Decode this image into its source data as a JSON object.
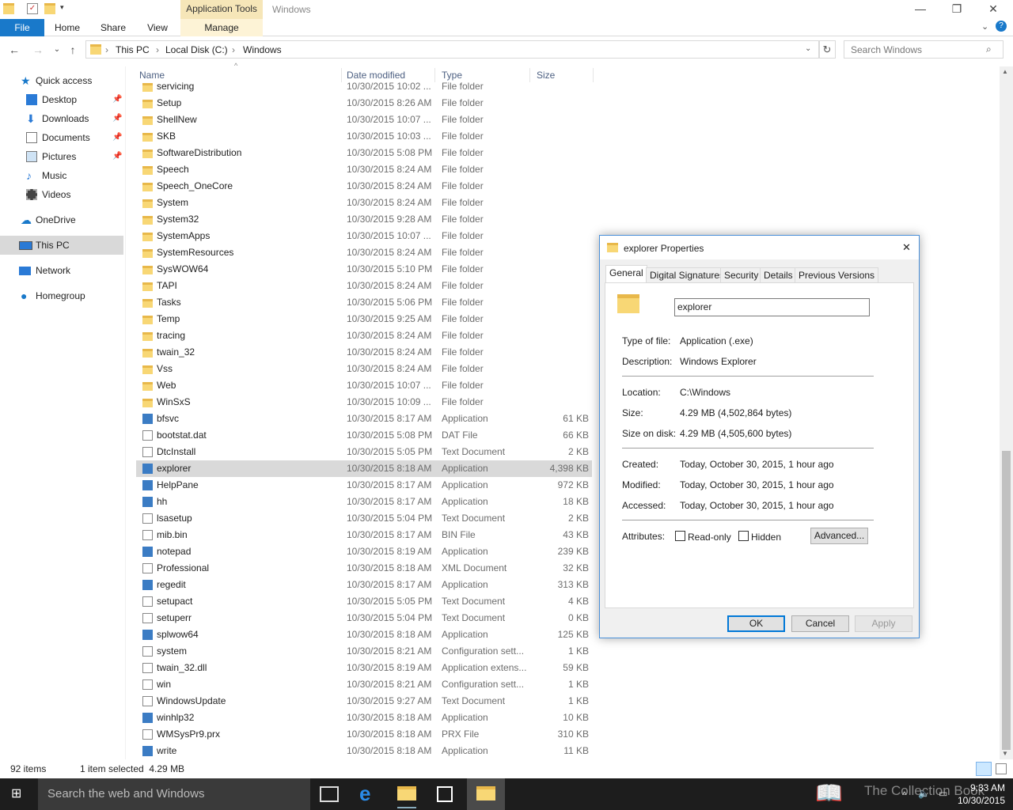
{
  "window": {
    "context_tab": "Application Tools",
    "title": "Windows",
    "min_icon": "minimize-icon",
    "max_icon": "restore-icon",
    "close_icon": "close-icon"
  },
  "ribbon": {
    "file": "File",
    "tabs": [
      "Home",
      "Share",
      "View"
    ],
    "manage": "Manage"
  },
  "address": {
    "crumbs": [
      "This PC",
      "Local Disk (C:)",
      "Windows"
    ],
    "search_placeholder": "Search Windows"
  },
  "nav": {
    "quick_access": "Quick access",
    "items": [
      "Desktop",
      "Downloads",
      "Documents",
      "Pictures",
      "Music",
      "Videos"
    ],
    "onedrive": "OneDrive",
    "thispc": "This PC",
    "network": "Network",
    "homegroup": "Homegroup"
  },
  "columns": {
    "name": "Name",
    "date": "Date modified",
    "type": "Type",
    "size": "Size"
  },
  "files": [
    {
      "name": "servicing",
      "date": "10/30/2015 10:02 ...",
      "type": "File folder",
      "size": "",
      "kind": "folder"
    },
    {
      "name": "Setup",
      "date": "10/30/2015 8:26 AM",
      "type": "File folder",
      "size": "",
      "kind": "folder"
    },
    {
      "name": "ShellNew",
      "date": "10/30/2015 10:07 ...",
      "type": "File folder",
      "size": "",
      "kind": "folder"
    },
    {
      "name": "SKB",
      "date": "10/30/2015 10:03 ...",
      "type": "File folder",
      "size": "",
      "kind": "folder"
    },
    {
      "name": "SoftwareDistribution",
      "date": "10/30/2015 5:08 PM",
      "type": "File folder",
      "size": "",
      "kind": "folder"
    },
    {
      "name": "Speech",
      "date": "10/30/2015 8:24 AM",
      "type": "File folder",
      "size": "",
      "kind": "folder"
    },
    {
      "name": "Speech_OneCore",
      "date": "10/30/2015 8:24 AM",
      "type": "File folder",
      "size": "",
      "kind": "folder"
    },
    {
      "name": "System",
      "date": "10/30/2015 8:24 AM",
      "type": "File folder",
      "size": "",
      "kind": "folder"
    },
    {
      "name": "System32",
      "date": "10/30/2015 9:28 AM",
      "type": "File folder",
      "size": "",
      "kind": "folder"
    },
    {
      "name": "SystemApps",
      "date": "10/30/2015 10:07 ...",
      "type": "File folder",
      "size": "",
      "kind": "folder"
    },
    {
      "name": "SystemResources",
      "date": "10/30/2015 8:24 AM",
      "type": "File folder",
      "size": "",
      "kind": "folder"
    },
    {
      "name": "SysWOW64",
      "date": "10/30/2015 5:10 PM",
      "type": "File folder",
      "size": "",
      "kind": "folder"
    },
    {
      "name": "TAPI",
      "date": "10/30/2015 8:24 AM",
      "type": "File folder",
      "size": "",
      "kind": "folder"
    },
    {
      "name": "Tasks",
      "date": "10/30/2015 5:06 PM",
      "type": "File folder",
      "size": "",
      "kind": "folder"
    },
    {
      "name": "Temp",
      "date": "10/30/2015 9:25 AM",
      "type": "File folder",
      "size": "",
      "kind": "folder"
    },
    {
      "name": "tracing",
      "date": "10/30/2015 8:24 AM",
      "type": "File folder",
      "size": "",
      "kind": "folder"
    },
    {
      "name": "twain_32",
      "date": "10/30/2015 8:24 AM",
      "type": "File folder",
      "size": "",
      "kind": "folder"
    },
    {
      "name": "Vss",
      "date": "10/30/2015 8:24 AM",
      "type": "File folder",
      "size": "",
      "kind": "folder"
    },
    {
      "name": "Web",
      "date": "10/30/2015 10:07 ...",
      "type": "File folder",
      "size": "",
      "kind": "folder"
    },
    {
      "name": "WinSxS",
      "date": "10/30/2015 10:09 ...",
      "type": "File folder",
      "size": "",
      "kind": "folder"
    },
    {
      "name": "bfsvc",
      "date": "10/30/2015 8:17 AM",
      "type": "Application",
      "size": "61 KB",
      "kind": "app"
    },
    {
      "name": "bootstat.dat",
      "date": "10/30/2015 5:08 PM",
      "type": "DAT File",
      "size": "66 KB",
      "kind": "file"
    },
    {
      "name": "DtcInstall",
      "date": "10/30/2015 5:05 PM",
      "type": "Text Document",
      "size": "2 KB",
      "kind": "file"
    },
    {
      "name": "explorer",
      "date": "10/30/2015 8:18 AM",
      "type": "Application",
      "size": "4,398 KB",
      "kind": "app"
    },
    {
      "name": "HelpPane",
      "date": "10/30/2015 8:17 AM",
      "type": "Application",
      "size": "972 KB",
      "kind": "app"
    },
    {
      "name": "hh",
      "date": "10/30/2015 8:17 AM",
      "type": "Application",
      "size": "18 KB",
      "kind": "app"
    },
    {
      "name": "lsasetup",
      "date": "10/30/2015 5:04 PM",
      "type": "Text Document",
      "size": "2 KB",
      "kind": "file"
    },
    {
      "name": "mib.bin",
      "date": "10/30/2015 8:17 AM",
      "type": "BIN File",
      "size": "43 KB",
      "kind": "file"
    },
    {
      "name": "notepad",
      "date": "10/30/2015 8:19 AM",
      "type": "Application",
      "size": "239 KB",
      "kind": "app"
    },
    {
      "name": "Professional",
      "date": "10/30/2015 8:18 AM",
      "type": "XML Document",
      "size": "32 KB",
      "kind": "file"
    },
    {
      "name": "regedit",
      "date": "10/30/2015 8:17 AM",
      "type": "Application",
      "size": "313 KB",
      "kind": "app"
    },
    {
      "name": "setupact",
      "date": "10/30/2015 5:05 PM",
      "type": "Text Document",
      "size": "4 KB",
      "kind": "file"
    },
    {
      "name": "setuperr",
      "date": "10/30/2015 5:04 PM",
      "type": "Text Document",
      "size": "0 KB",
      "kind": "file"
    },
    {
      "name": "splwow64",
      "date": "10/30/2015 8:18 AM",
      "type": "Application",
      "size": "125 KB",
      "kind": "app"
    },
    {
      "name": "system",
      "date": "10/30/2015 8:21 AM",
      "type": "Configuration sett...",
      "size": "1 KB",
      "kind": "file"
    },
    {
      "name": "twain_32.dll",
      "date": "10/30/2015 8:19 AM",
      "type": "Application extens...",
      "size": "59 KB",
      "kind": "file"
    },
    {
      "name": "win",
      "date": "10/30/2015 8:21 AM",
      "type": "Configuration sett...",
      "size": "1 KB",
      "kind": "file"
    },
    {
      "name": "WindowsUpdate",
      "date": "10/30/2015 9:27 AM",
      "type": "Text Document",
      "size": "1 KB",
      "kind": "file"
    },
    {
      "name": "winhlp32",
      "date": "10/30/2015 8:18 AM",
      "type": "Application",
      "size": "10 KB",
      "kind": "app"
    },
    {
      "name": "WMSysPr9.prx",
      "date": "10/30/2015 8:18 AM",
      "type": "PRX File",
      "size": "310 KB",
      "kind": "file"
    },
    {
      "name": "write",
      "date": "10/30/2015 8:18 AM",
      "type": "Application",
      "size": "11 KB",
      "kind": "app"
    }
  ],
  "selected_index": 23,
  "status": {
    "count": "92 items",
    "selection": "1 item selected  4.29 MB"
  },
  "taskbar": {
    "search": "Search the web and Windows",
    "time": "9:33 AM",
    "date": "10/30/2015",
    "watermark": "The Collection Book"
  },
  "dialog": {
    "title": "explorer Properties",
    "tabs": [
      "General",
      "Digital Signatures",
      "Security",
      "Details",
      "Previous Versions"
    ],
    "filename": "explorer",
    "type_label": "Type of file:",
    "type_value": "Application (.exe)",
    "desc_label": "Description:",
    "desc_value": "Windows Explorer",
    "loc_label": "Location:",
    "loc_value": "C:\\Windows",
    "size_label": "Size:",
    "size_value": "4.29 MB (4,502,864 bytes)",
    "disk_label": "Size on disk:",
    "disk_value": "4.29 MB (4,505,600 bytes)",
    "created_label": "Created:",
    "created_value": "Today, October 30, 2015, 1 hour ago",
    "modified_label": "Modified:",
    "modified_value": "Today, October 30, 2015, 1 hour ago",
    "accessed_label": "Accessed:",
    "accessed_value": "Today, October 30, 2015, 1 hour ago",
    "attr_label": "Attributes:",
    "readonly": "Read-only",
    "hidden": "Hidden",
    "advanced": "Advanced...",
    "ok": "OK",
    "cancel": "Cancel",
    "apply": "Apply"
  },
  "colors": {
    "accent": "#1979ca",
    "context": "#f6e6b8",
    "selection": "#d9d9d9"
  }
}
